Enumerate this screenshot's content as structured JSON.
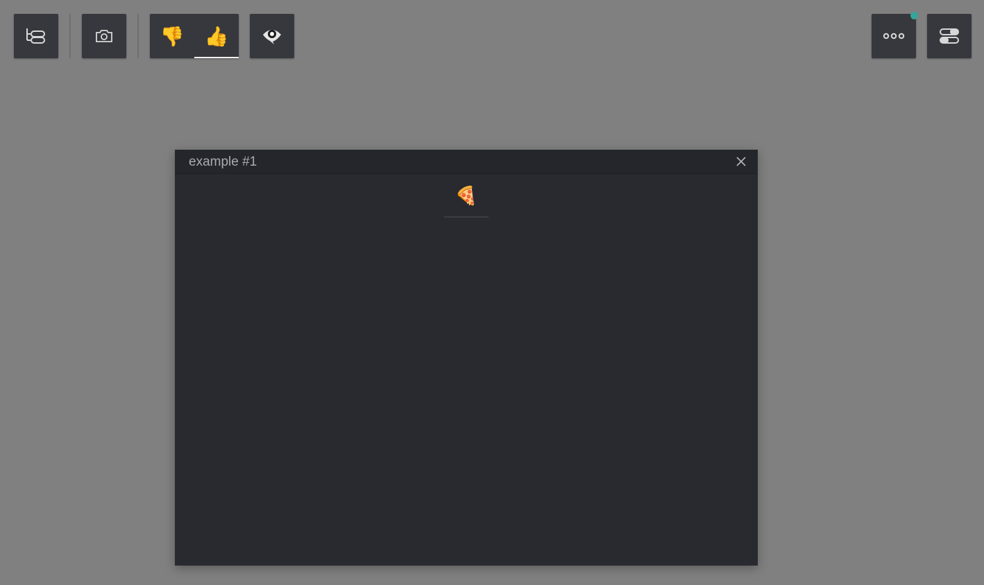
{
  "toolbar": {
    "left": [
      {
        "icon": "tree-list-icon"
      },
      {
        "icon": "camera-icon"
      }
    ],
    "reaction_group": {
      "items": [
        {
          "emoji": "👎",
          "icon": "thumbs-down-icon",
          "active": false
        },
        {
          "emoji": "👍",
          "icon": "thumbs-up-icon",
          "active": true
        }
      ]
    },
    "eye": {
      "icon": "eye-icon"
    },
    "right": [
      {
        "icon": "more-dots-icon",
        "badge_color": "#37a39a"
      },
      {
        "icon": "toggle-settings-icon"
      }
    ]
  },
  "panel": {
    "title": "example #1",
    "close_icon": "close-icon",
    "tabs": [
      {
        "emoji": "🍕",
        "icon": "pizza-icon"
      }
    ]
  },
  "colors": {
    "background": "#808080",
    "button": "#36383d",
    "panel": "#292a2f",
    "accent": "#37a39a"
  }
}
